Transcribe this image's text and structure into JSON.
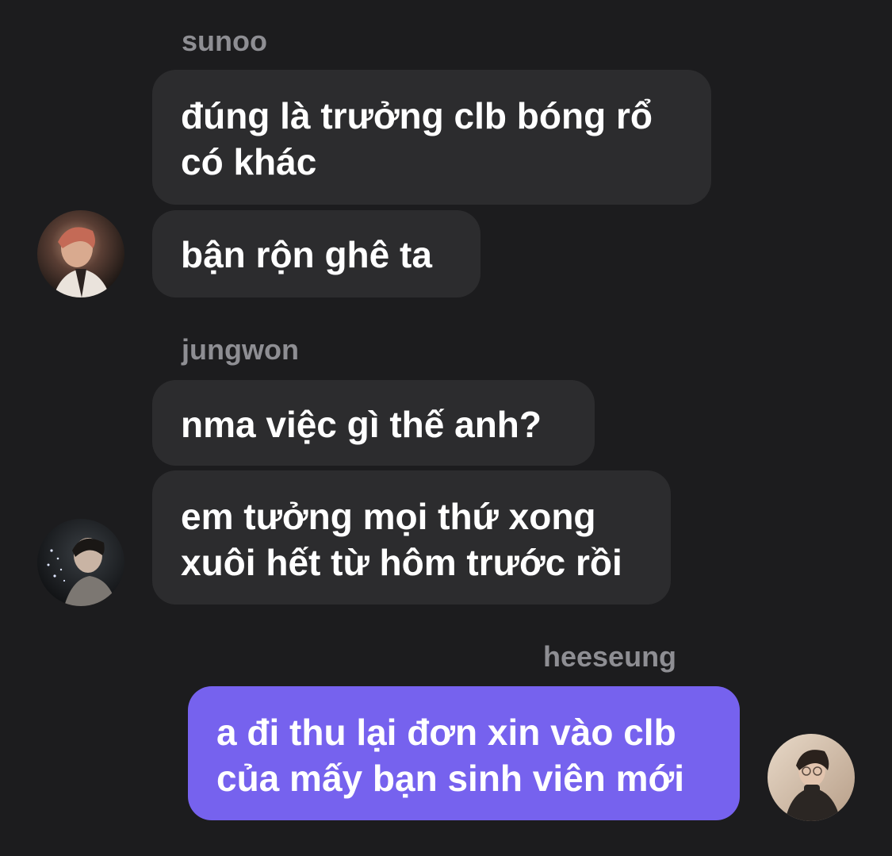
{
  "messages": [
    {
      "sender": "sunoo",
      "lines": [
        [
          "đúng là trưởng clb bóng rổ",
          "có khác"
        ],
        [
          "bận rộn ghê ta"
        ]
      ],
      "avatar_icon": "sunoo-avatar"
    },
    {
      "sender": "jungwon",
      "lines": [
        [
          "nma việc gì thế anh?"
        ],
        [
          "em tưởng mọi thứ xong",
          "xuôi hết từ hôm trước rồi"
        ]
      ],
      "avatar_icon": "jungwon-avatar"
    },
    {
      "sender": "heeseung",
      "lines": [
        [
          "a đi thu lại đơn xin vào clb",
          "của mấy bạn sinh viên mới"
        ]
      ],
      "avatar_icon": "heeseung-avatar"
    }
  ],
  "colors": {
    "background": "#1c1c1e",
    "incoming_bubble": "#2c2c2e",
    "outgoing_bubble": "#7662ee",
    "sender_name": "#8e8e93",
    "text": "#ffffff"
  }
}
